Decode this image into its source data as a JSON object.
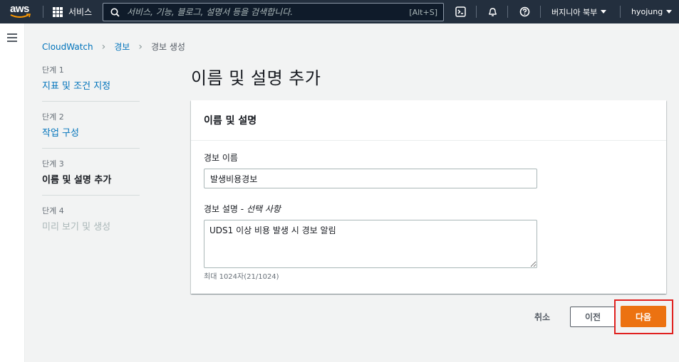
{
  "topnav": {
    "logo_text": "aws",
    "services_label": "서비스",
    "search_placeholder": "서비스, 기능, 블로그, 설명서 등을 검색합니다.",
    "search_shortcut": "[Alt+S]",
    "region_label": "버지니아 북부",
    "user_label": "hyojung"
  },
  "breadcrumb": [
    {
      "label": "CloudWatch"
    },
    {
      "label": "경보"
    },
    {
      "label": "경보 생성"
    }
  ],
  "steps": [
    {
      "number": "단계 1",
      "label": "지표 및 조건 지정",
      "state": "link"
    },
    {
      "number": "단계 2",
      "label": "작업 구성",
      "state": "link"
    },
    {
      "number": "단계 3",
      "label": "이름 및 설명 추가",
      "state": "active"
    },
    {
      "number": "단계 4",
      "label": "미리 보기 및 생성",
      "state": "disabled"
    }
  ],
  "page_title": "이름 및 설명 추가",
  "panel": {
    "header": "이름 및 설명",
    "name_label": "경보 이름",
    "name_value": "발생비용경보",
    "desc_label": "경보 설명 - ",
    "desc_optional": "선택 사항",
    "desc_value": "UDS1 이상 비용 발생 시 경보 알림",
    "desc_hint": "최대 1024자(21/1024)"
  },
  "actions": {
    "cancel": "취소",
    "previous": "이전",
    "next": "다음"
  },
  "colors": {
    "nav_bg": "#232f3e",
    "link": "#0073bb",
    "primary": "#ec7211",
    "highlight": "#e0211f"
  }
}
